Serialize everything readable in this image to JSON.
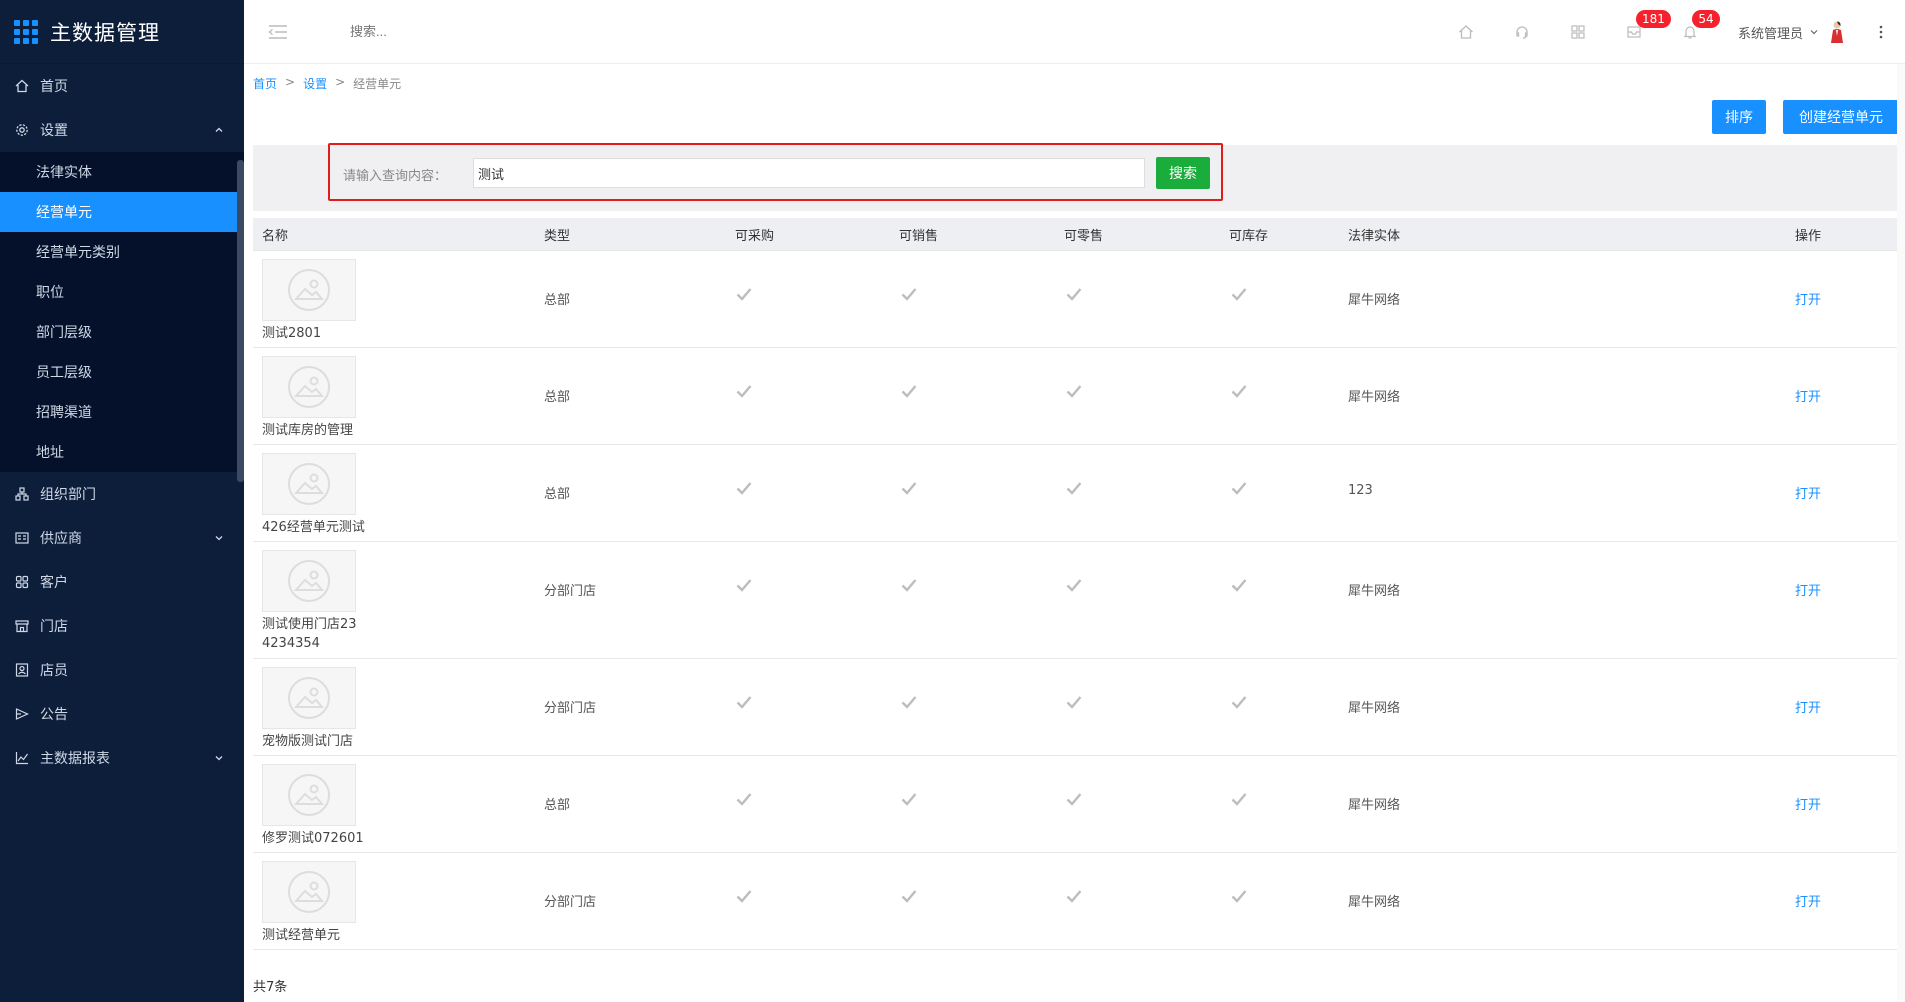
{
  "app": {
    "title": "主数据管理"
  },
  "sidebar": {
    "items": [
      {
        "label": "首页",
        "icon": "home-icon"
      },
      {
        "label": "设置",
        "icon": "gear-icon",
        "expanded": true,
        "children": [
          {
            "label": "法律实体",
            "active": false
          },
          {
            "label": "经营单元",
            "active": true
          },
          {
            "label": "经营单元类别",
            "active": false
          },
          {
            "label": "职位",
            "active": false
          },
          {
            "label": "部门层级",
            "active": false
          },
          {
            "label": "员工层级",
            "active": false
          },
          {
            "label": "招聘渠道",
            "active": false
          },
          {
            "label": "地址",
            "active": false
          }
        ]
      },
      {
        "label": "组织部门",
        "icon": "org-icon"
      },
      {
        "label": "供应商",
        "icon": "supplier-icon",
        "has_children": true
      },
      {
        "label": "客户",
        "icon": "customer-icon"
      },
      {
        "label": "门店",
        "icon": "store-icon"
      },
      {
        "label": "店员",
        "icon": "clerk-icon"
      },
      {
        "label": "公告",
        "icon": "announce-icon"
      },
      {
        "label": "主数据报表",
        "icon": "report-icon",
        "has_children": true
      }
    ]
  },
  "header": {
    "search_placeholder": "搜索...",
    "badges": {
      "messages": "181",
      "notifications": "54"
    },
    "user_name": "系统管理员"
  },
  "breadcrumb": [
    "首页",
    "设置",
    "经营单元"
  ],
  "toolbar": {
    "sort_label": "排序",
    "create_label": "创建经营单元"
  },
  "search": {
    "label": "请输入查询内容：",
    "value": "测试",
    "button": "搜索"
  },
  "table": {
    "headers": [
      "名称",
      "类型",
      "可采购",
      "可销售",
      "可零售",
      "可库存",
      "法律实体",
      "操作"
    ],
    "rows": [
      {
        "name": "测试2801",
        "type": "总部",
        "purchasable": true,
        "sellable": true,
        "retail": true,
        "stock": true,
        "legal": "犀牛网络",
        "action": "打开"
      },
      {
        "name": "测试库房的管理",
        "type": "总部",
        "purchasable": true,
        "sellable": true,
        "retail": true,
        "stock": true,
        "legal": "犀牛网络",
        "action": "打开"
      },
      {
        "name": "426经营单元测试",
        "type": "总部",
        "purchasable": true,
        "sellable": true,
        "retail": true,
        "stock": true,
        "legal": "123",
        "action": "打开"
      },
      {
        "name": "测试使用门店234234354",
        "type": "分部门店",
        "purchasable": true,
        "sellable": true,
        "retail": true,
        "stock": true,
        "legal": "犀牛网络",
        "action": "打开"
      },
      {
        "name": "宠物版测试门店",
        "type": "分部门店",
        "purchasable": true,
        "sellable": true,
        "retail": true,
        "stock": true,
        "legal": "犀牛网络",
        "action": "打开"
      },
      {
        "name": "修罗测试072601",
        "type": "总部",
        "purchasable": true,
        "sellable": true,
        "retail": true,
        "stock": true,
        "legal": "犀牛网络",
        "action": "打开"
      },
      {
        "name": "测试经营单元",
        "type": "分部门店",
        "purchasable": true,
        "sellable": true,
        "retail": true,
        "stock": true,
        "legal": "犀牛网络",
        "action": "打开"
      }
    ],
    "total_text": "共7条"
  },
  "colors": {
    "sidebar_bg": "#0d1e3a",
    "submenu_bg": "#05112a",
    "accent": "#1890ff",
    "search_button": "#1aad3b",
    "highlight_border": "#e21b1b",
    "badge": "#f5222d"
  }
}
